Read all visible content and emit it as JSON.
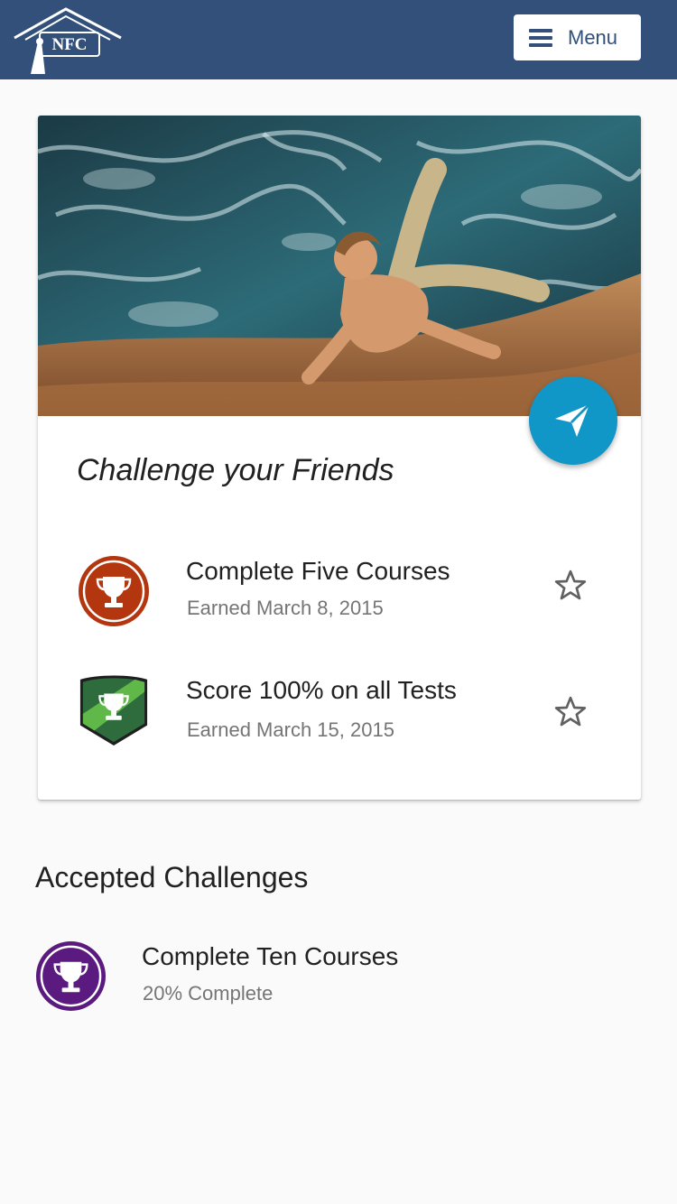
{
  "header": {
    "logo_text": "NFC",
    "menu_label": "Menu"
  },
  "card": {
    "title": "Challenge your Friends",
    "fab_icon": "paper-plane-icon",
    "achievements": [
      {
        "title": "Complete Five Courses",
        "subtitle": "Earned March 8, 2015",
        "badge": "trophy-circle-icon",
        "badge_color": "#b3360f"
      },
      {
        "title": "Score 100% on all Tests",
        "subtitle": "Earned March 15, 2015",
        "badge": "trophy-shield-icon",
        "badge_color": "#2f8a45"
      }
    ]
  },
  "accepted": {
    "heading": "Accepted Challenges",
    "items": [
      {
        "title": "Complete Ten Courses",
        "subtitle": "20% Complete",
        "badge": "trophy-circle-icon",
        "badge_color": "#5a1a80"
      }
    ]
  },
  "colors": {
    "header_bg": "#32507a",
    "fab": "#1196c8"
  }
}
